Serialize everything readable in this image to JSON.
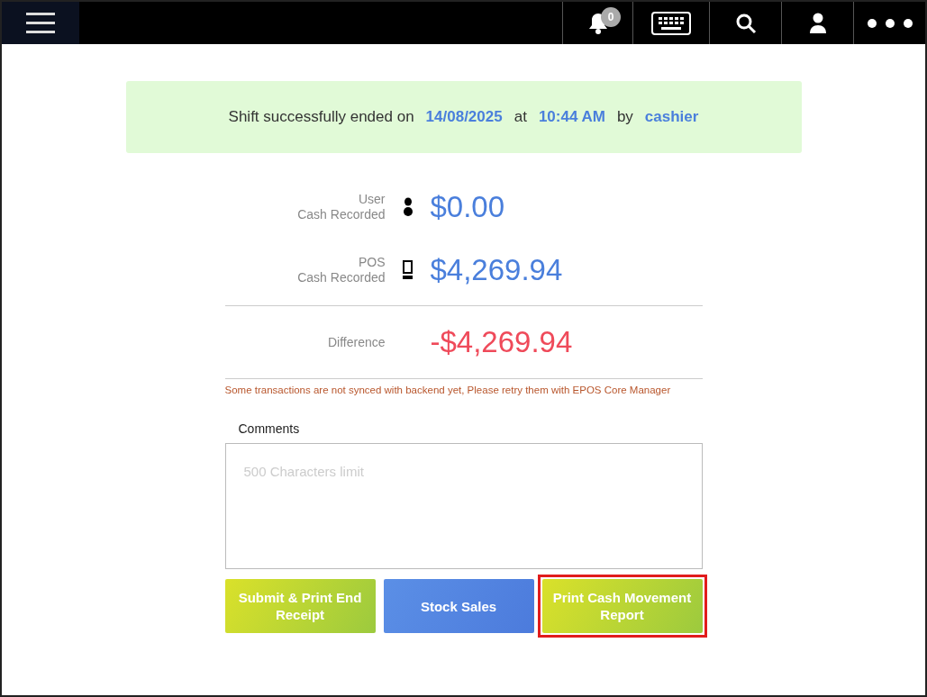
{
  "toolbar": {
    "notification_count": "0"
  },
  "banner": {
    "parts": [
      {
        "kind": "plain",
        "text": "Shift successfully ended on"
      },
      {
        "kind": "value",
        "text": "14/08/2025"
      },
      {
        "kind": "plain",
        "text": "at"
      },
      {
        "kind": "value",
        "text": "10:44 AM"
      },
      {
        "kind": "plain",
        "text": "by"
      },
      {
        "kind": "value",
        "text": "cashier"
      }
    ]
  },
  "totals": [
    {
      "kind": "user",
      "label_1": "User",
      "label_2": "Cash Recorded",
      "amount": "$0.00"
    },
    {
      "kind": "pos",
      "label_1": "POS",
      "label_2": "Cash Recorded",
      "amount": "$4,269.94"
    }
  ],
  "difference": {
    "label": "Difference",
    "amount": "-$4,269.94",
    "negative": true
  },
  "warning": "Some transactions are not synced with backend yet, Please retry them with EPOS Core Manager",
  "comments": {
    "label": "Comments",
    "placeholder": "500 Characters limit"
  },
  "buttons": [
    {
      "kind": "green",
      "label": "Submit & Print End Receipt",
      "highlighted": false
    },
    {
      "kind": "blue",
      "label": "Stock Sales",
      "highlighted": false
    },
    {
      "kind": "green",
      "label": "Print Cash Movement Report",
      "highlighted": true
    }
  ]
}
